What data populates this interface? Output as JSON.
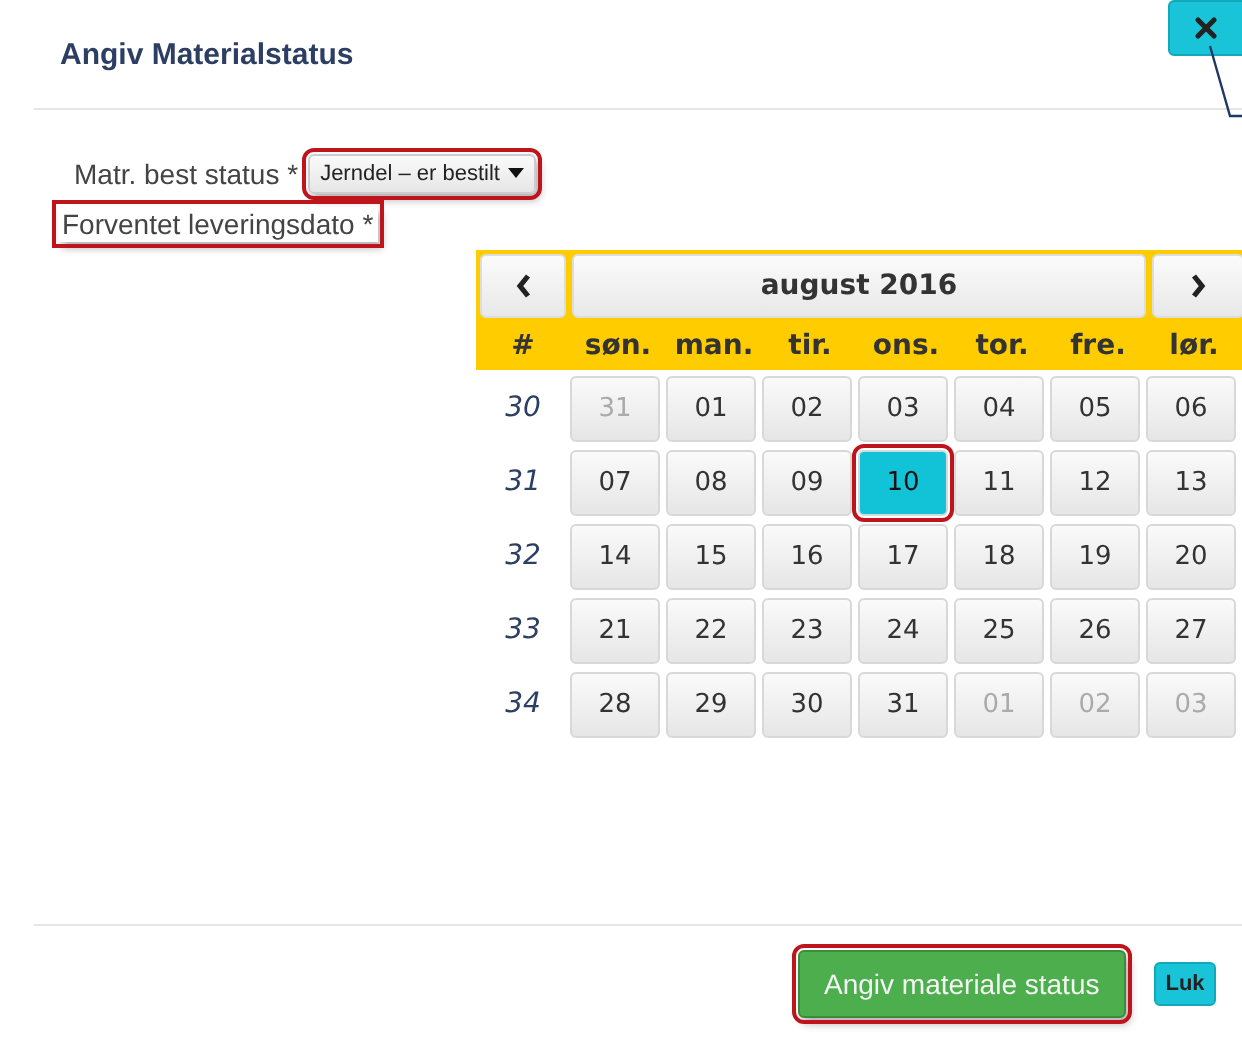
{
  "dialog": {
    "title": "Angiv Materialstatus"
  },
  "status_field": {
    "label": "Matr. best status *",
    "value": "Jerndel – er bestilt",
    "highlighted": true
  },
  "date_field": {
    "label": "Forventet leveringsdato *",
    "highlighted": true
  },
  "calendar": {
    "title": "august 2016",
    "week_header": "#",
    "weekdays": [
      "søn.",
      "man.",
      "tir.",
      "ons.",
      "tor.",
      "fre.",
      "lør."
    ],
    "weeks": [
      {
        "number": "30",
        "days": [
          {
            "label": "31",
            "muted": true,
            "selected": false
          },
          {
            "label": "01",
            "muted": false,
            "selected": false
          },
          {
            "label": "02",
            "muted": false,
            "selected": false
          },
          {
            "label": "03",
            "muted": false,
            "selected": false
          },
          {
            "label": "04",
            "muted": false,
            "selected": false
          },
          {
            "label": "05",
            "muted": false,
            "selected": false
          },
          {
            "label": "06",
            "muted": false,
            "selected": false
          }
        ]
      },
      {
        "number": "31",
        "days": [
          {
            "label": "07",
            "muted": false,
            "selected": false
          },
          {
            "label": "08",
            "muted": false,
            "selected": false
          },
          {
            "label": "09",
            "muted": false,
            "selected": false
          },
          {
            "label": "10",
            "muted": false,
            "selected": true
          },
          {
            "label": "11",
            "muted": false,
            "selected": false
          },
          {
            "label": "12",
            "muted": false,
            "selected": false
          },
          {
            "label": "13",
            "muted": false,
            "selected": false
          }
        ]
      },
      {
        "number": "32",
        "days": [
          {
            "label": "14",
            "muted": false,
            "selected": false
          },
          {
            "label": "15",
            "muted": false,
            "selected": false
          },
          {
            "label": "16",
            "muted": false,
            "selected": false
          },
          {
            "label": "17",
            "muted": false,
            "selected": false
          },
          {
            "label": "18",
            "muted": false,
            "selected": false
          },
          {
            "label": "19",
            "muted": false,
            "selected": false
          },
          {
            "label": "20",
            "muted": false,
            "selected": false
          }
        ]
      },
      {
        "number": "33",
        "days": [
          {
            "label": "21",
            "muted": false,
            "selected": false
          },
          {
            "label": "22",
            "muted": false,
            "selected": false
          },
          {
            "label": "23",
            "muted": false,
            "selected": false
          },
          {
            "label": "24",
            "muted": false,
            "selected": false
          },
          {
            "label": "25",
            "muted": false,
            "selected": false
          },
          {
            "label": "26",
            "muted": false,
            "selected": false
          },
          {
            "label": "27",
            "muted": false,
            "selected": false
          }
        ]
      },
      {
        "number": "34",
        "days": [
          {
            "label": "28",
            "muted": false,
            "selected": false
          },
          {
            "label": "29",
            "muted": false,
            "selected": false
          },
          {
            "label": "30",
            "muted": false,
            "selected": false
          },
          {
            "label": "31",
            "muted": false,
            "selected": false
          },
          {
            "label": "01",
            "muted": true,
            "selected": false
          },
          {
            "label": "02",
            "muted": true,
            "selected": false
          },
          {
            "label": "03",
            "muted": true,
            "selected": false
          }
        ]
      }
    ]
  },
  "buttons": [
    {
      "label": "Angiv materiale status",
      "kind": "primary",
      "highlighted": true
    },
    {
      "label": "Luk",
      "kind": "secondary",
      "highlighted": false
    }
  ]
}
